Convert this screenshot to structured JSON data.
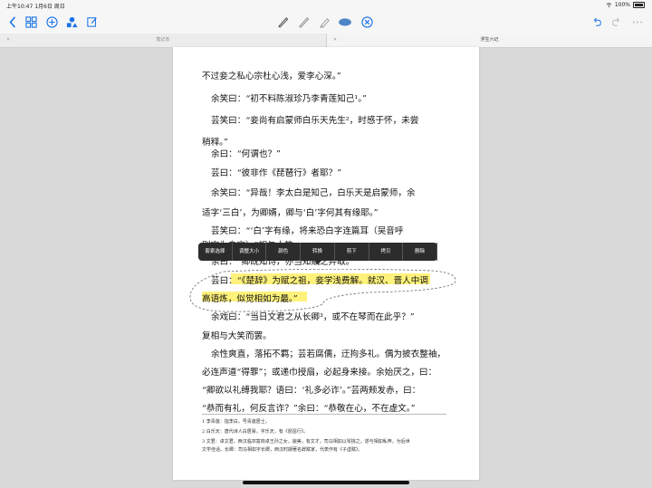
{
  "status_bar": {
    "time": "上午10:47",
    "date": "1月6日 周日",
    "battery": "100%"
  },
  "tabs": [
    {
      "label": "笔记本"
    },
    {
      "label": "浮生六记"
    }
  ],
  "document": {
    "lines": [
      "不过妾之私心宗杜心浅，爱李心深。”",
      "余笑曰：“初不料陈淑珍乃李青莲知己¹。”",
      "芸笑曰：“妾尚有启蒙师白乐天先生²，时感于怀，未尝",
      "稍释。”",
      "余曰：“何谓也？”",
      "芸曰：“彼非作《琵琶行》者耶？”",
      "余笑曰：“异哉！李太白是知己，白乐天是启蒙师，余",
      "适字‘三白’，为卿婿，卿与‘白’字何其有缘耶。”",
      "芸笑曰：“‘白’字有缘，将来恐白字连篇耳（吴音呼",
      "别字为白字）。”相与大笑。",
      "余曰：“卿既知诗，亦当知赋之弃取。”",
      "芸曰：“《楚辞》为赋之祖，妾学浅费解。就汉、晋人中调",
      "高语炼，似觉相如为最。”",
      "余戏曰：“当日文君之从长卿³，或不在琴而在此乎？”",
      "复相与大笑而罢。",
      "余性爽直，落拓不羁；芸若腐儒，迂拘多礼。偶为披衣整袖，",
      "必连声道“得罪”；或递巾授扇，必起身来接。余始厌之，曰：",
      "“卿欲以礼缚我耶？语曰：‘礼多必诈’。”芸两颊发赤，曰：",
      "“恭而有礼，何反言诈？”余曰：“恭敬在心，不在虚文。”"
    ],
    "footnotes": [
      "1  李青莲：指李白，号青莲居士。",
      "2  白乐天：唐代诗人白居易，字乐天，有《琵琶行》。",
      "3  文君：卓文君，西汉临邛富商卓王孙之女，貌美，有文才，司马相如以琴挑之，遂与相如私奔，为后世",
      "   文学佳话。长卿：司马相如字长卿，西汉时期著名辞赋家，代表作有《子虚赋》。"
    ]
  },
  "context_menu": {
    "items": [
      "套索选择",
      "调整大小",
      "颜色",
      "转换",
      "剪下",
      "拷贝",
      "删除"
    ]
  }
}
